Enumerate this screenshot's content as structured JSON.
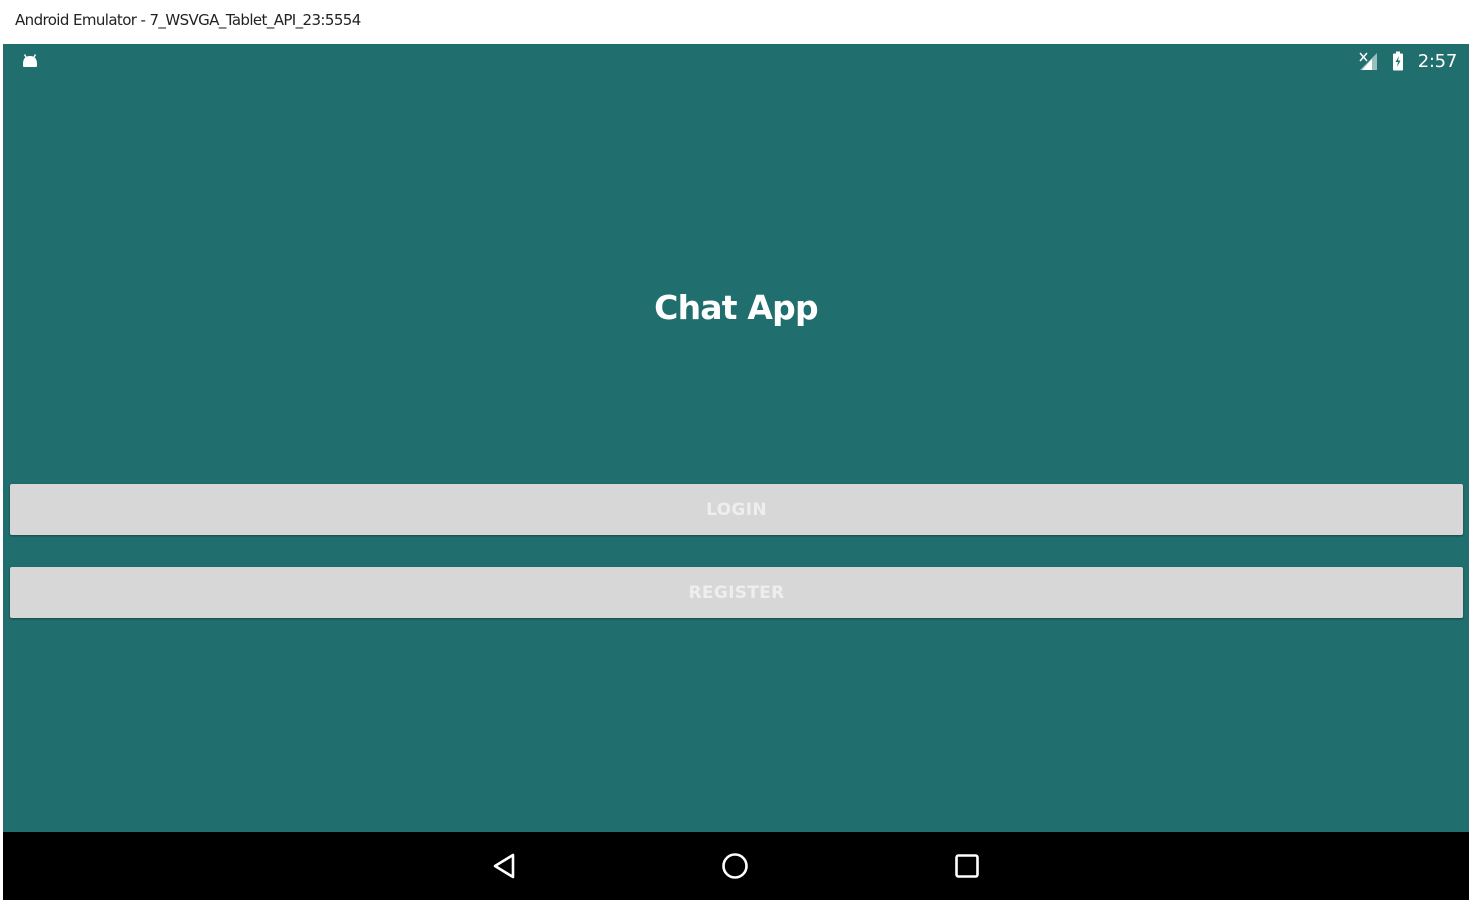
{
  "window": {
    "title": "Android Emulator - 7_WSVGA_Tablet_API_23:5554"
  },
  "status_bar": {
    "left_icon": "android-icon",
    "right_icons": [
      "signal-icon",
      "battery-icon"
    ],
    "time": "2:57"
  },
  "app": {
    "title": "Chat App",
    "background_color": "#216e6e"
  },
  "buttons": {
    "login_label": "LOGIN",
    "register_label": "REGISTER",
    "button_color": "#d7d7d7"
  },
  "nav_bar": {
    "items": [
      "back-icon",
      "home-icon",
      "recents-icon"
    ]
  }
}
